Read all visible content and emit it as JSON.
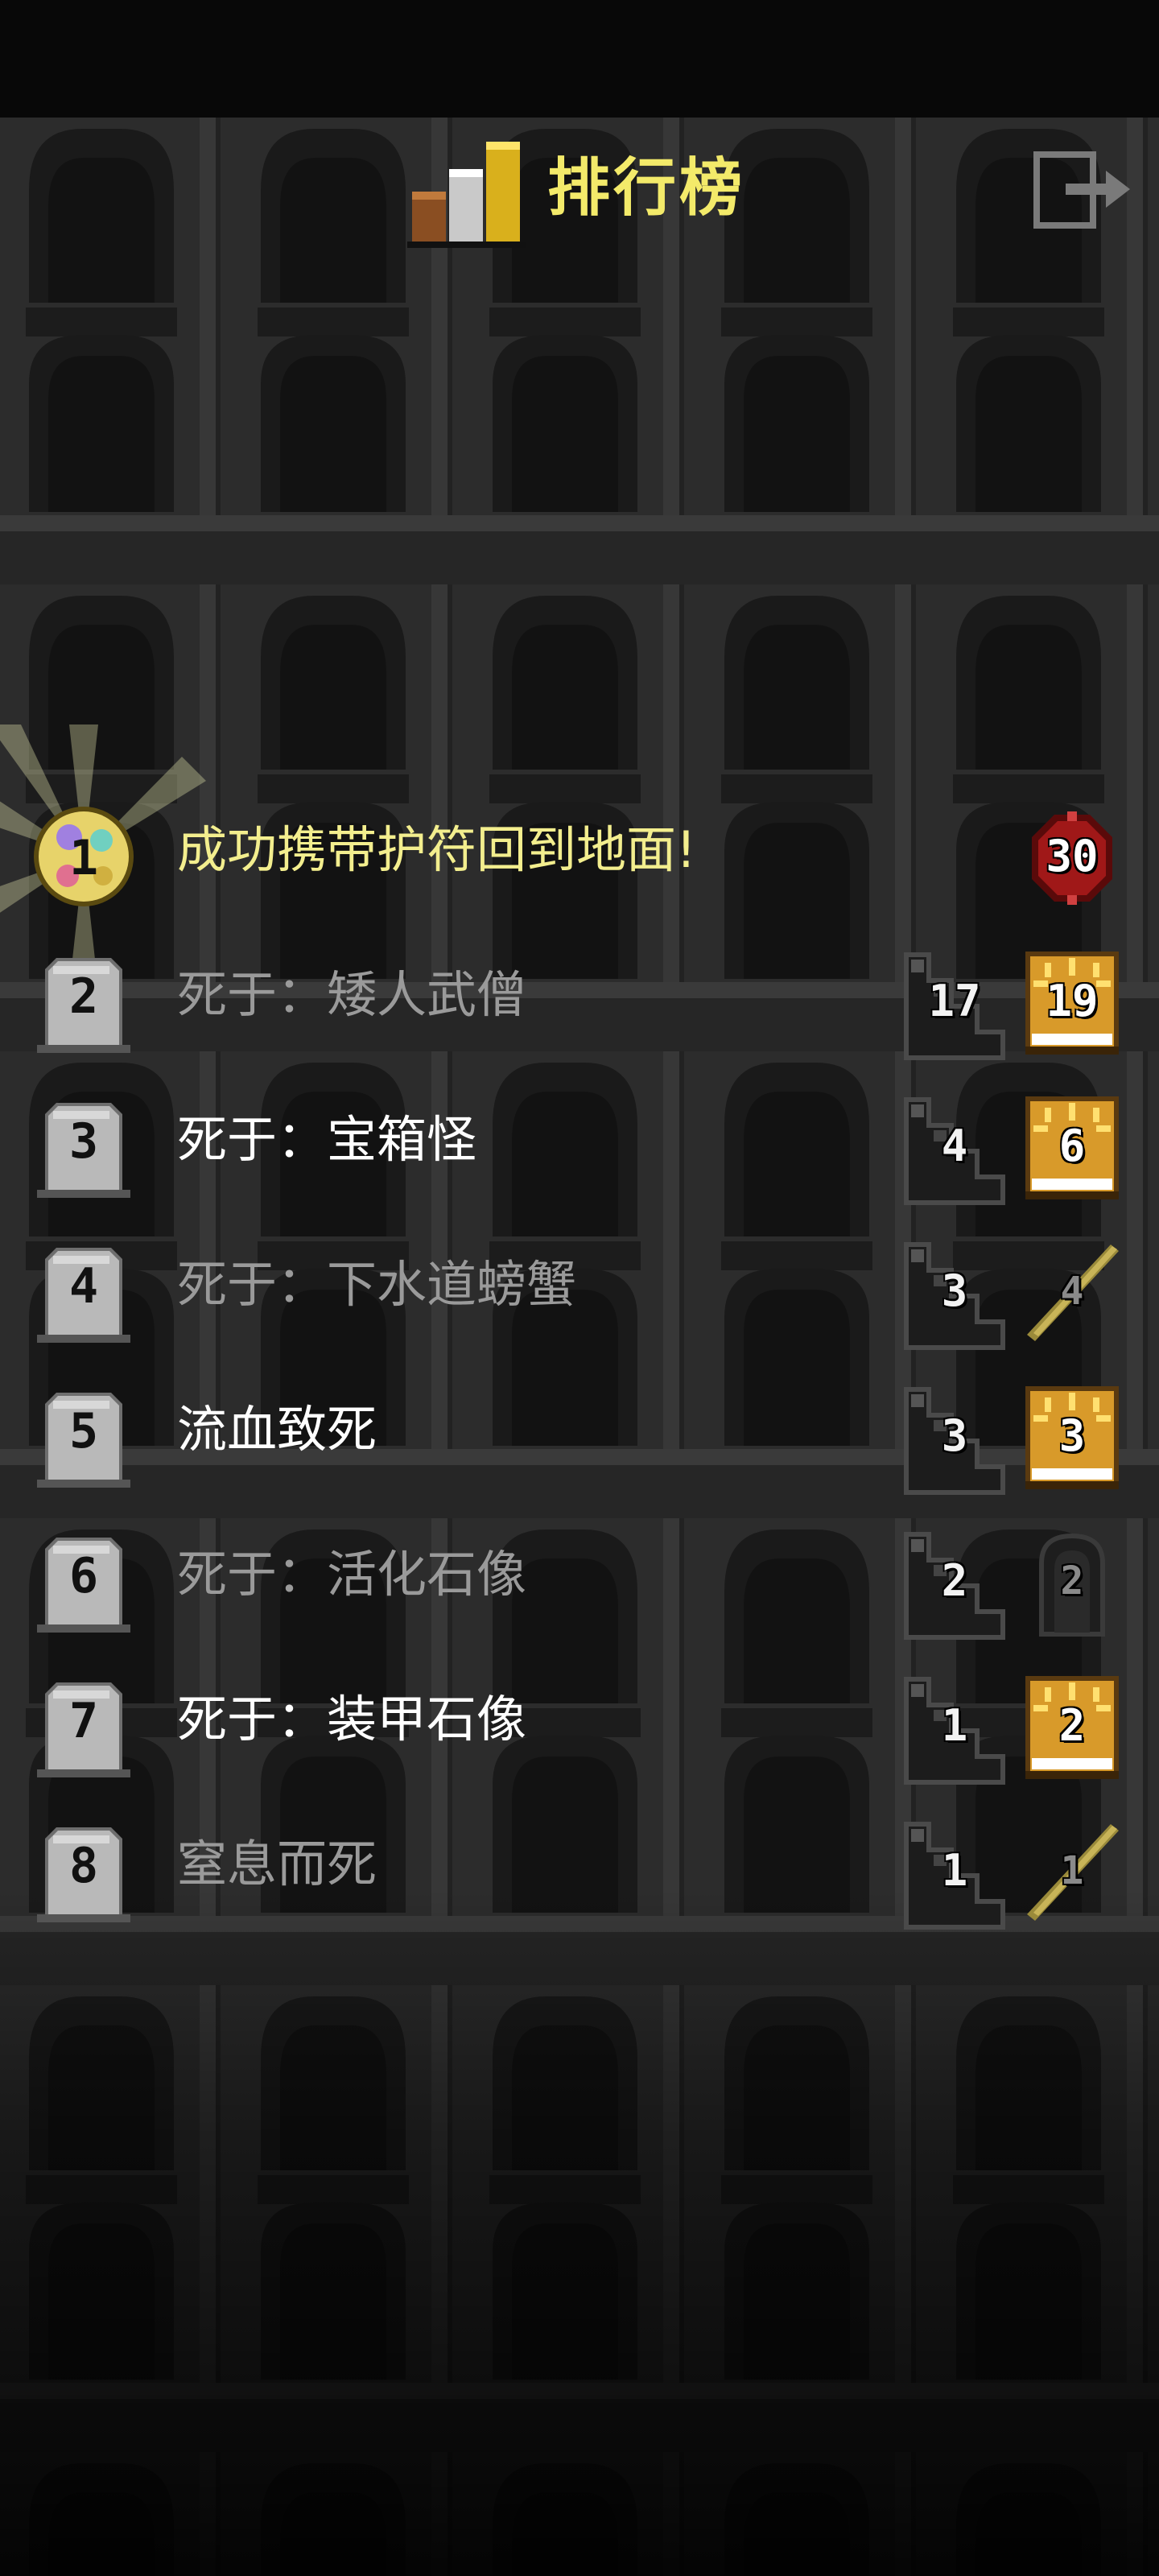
{
  "header": {
    "title": "排行榜"
  },
  "icons": {
    "title": "podium-icon",
    "exit": "exit-door-icon",
    "rank_win": "amulet-icon",
    "rank": "tombstone-icon",
    "depth": "stairs-icon",
    "level_warrior": "warrior-class-icon",
    "level_huntress": "bow-class-icon",
    "level_rogue": "hooded-class-icon",
    "level_win": "challenge-badge-icon"
  },
  "colors": {
    "title": "#f3ea6a",
    "win_text": "#f3ee8e",
    "bright_text": "#ffffff",
    "dim_text": "#9a9a9a"
  },
  "entries": [
    {
      "rank": "1",
      "text": "成功携带护符回到地面!",
      "depth": "",
      "level": "30",
      "style": "win",
      "class": "win"
    },
    {
      "rank": "2",
      "text": "死于：矮人武僧",
      "depth": "17",
      "level": "19",
      "style": "dim",
      "class": "warrior"
    },
    {
      "rank": "3",
      "text": "死于：宝箱怪",
      "depth": "4",
      "level": "6",
      "style": "bright",
      "class": "warrior"
    },
    {
      "rank": "4",
      "text": "死于：下水道螃蟹",
      "depth": "3",
      "level": "4",
      "style": "dim",
      "class": "huntress"
    },
    {
      "rank": "5",
      "text": "流血致死",
      "depth": "3",
      "level": "3",
      "style": "bright",
      "class": "warrior"
    },
    {
      "rank": "6",
      "text": "死于：活化石像",
      "depth": "2",
      "level": "2",
      "style": "dim",
      "class": "rogue"
    },
    {
      "rank": "7",
      "text": "死于：装甲石像",
      "depth": "1",
      "level": "2",
      "style": "bright",
      "class": "warrior"
    },
    {
      "rank": "8",
      "text": "窒息而死",
      "depth": "1",
      "level": "1",
      "style": "dim",
      "class": "huntress"
    }
  ]
}
